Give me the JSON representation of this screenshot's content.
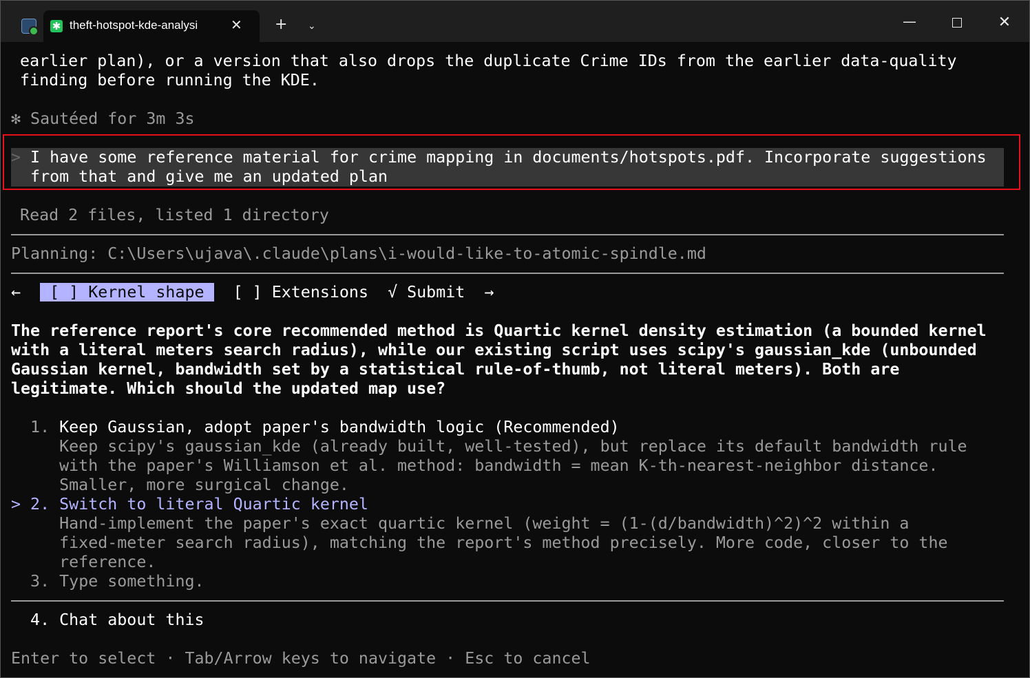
{
  "titlebar": {
    "tab_title": "theft-hotspot-kde-analysi",
    "tab_icon": "✱",
    "close_glyph": "✕",
    "newtab_glyph": "+",
    "dropdown_glyph": "⌄",
    "minimize_glyph": "—",
    "close_window_glyph": "✕"
  },
  "terminal": {
    "prev_line1": "  earlier plan), or a version that also drops the duplicate Crime IDs from the earlier data-quality",
    "prev_line2": "  finding before running the KDE.",
    "status_icon": "✻",
    "status_text": " Sautéed for 3m 3s",
    "user_prompt_marker": ">",
    "user_line1": " I have some reference material for crime mapping in documents/hotspots.pdf. Incorporate suggestions",
    "user_line2": "  from that and give me an updated plan",
    "tool_summary": "  Read 2 files, listed 1 directory",
    "planning_label": "Planning: C:\\Users\\ujava\\.claude\\plans\\i-would-like-to-atomic-spindle.md",
    "nav": {
      "left_arrow": "←",
      "tab_kernel": " [ ] Kernel shape ",
      "tab_extensions": "[ ] Extensions",
      "tab_submit": "√ Submit",
      "right_arrow": "→"
    },
    "question": [
      "The reference report's core recommended method is Quartic kernel density estimation (a bounded kernel",
      "with a literal meters search radius), while our existing script uses scipy's gaussian_kde (unbounded",
      "Gaussian kernel, bandwidth set by a statistical rule-of-thumb, not literal meters). Both are",
      "legitimate. Which should the updated map use?"
    ],
    "options": [
      {
        "prefix": "  1. ",
        "label": "Keep Gaussian, adopt paper's bandwidth logic (Recommended)",
        "desc": [
          "     Keep scipy's gaussian_kde (already built, well-tested), but replace its default bandwidth rule",
          "     with the paper's Williamson et al. method: bandwidth = mean K-th-nearest-neighbor distance.",
          "     Smaller, more surgical change."
        ]
      },
      {
        "prefix": "> 2. ",
        "label": "Switch to literal Quartic kernel",
        "desc": [
          "     Hand-implement the paper's exact quartic kernel (weight = (1-(d/bandwidth)^2)^2 within a",
          "     fixed-meter search radius), matching the report's method precisely. More code, closer to the",
          "     reference."
        ]
      },
      {
        "prefix": "  3. ",
        "label": "Type something.",
        "desc": []
      }
    ],
    "chat_option": "  4. Chat about this",
    "footer_hint": "Enter to select · Tab/Arrow keys to navigate · Esc to cancel"
  }
}
